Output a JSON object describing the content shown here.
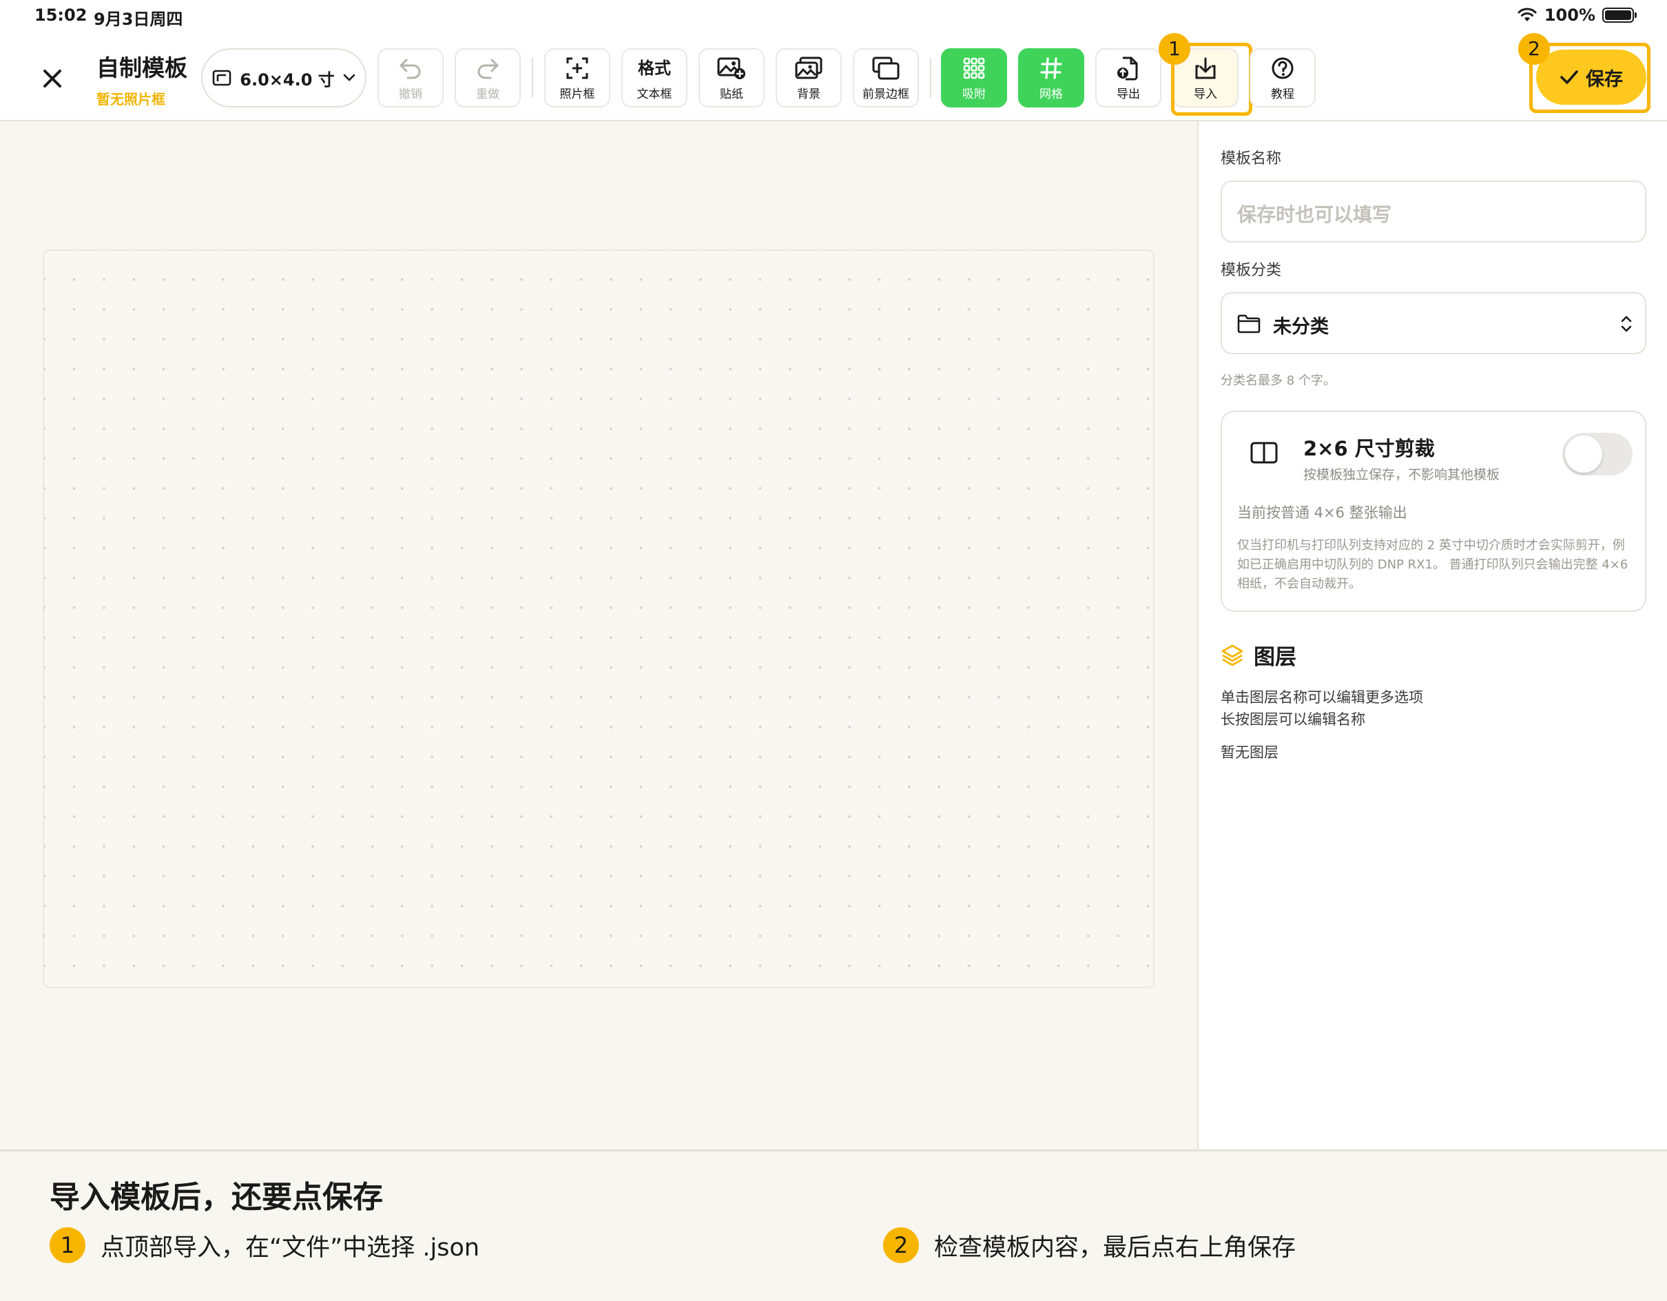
{
  "status_bar": {
    "time": "15:02",
    "date": "9月3日周四",
    "battery": "100%"
  },
  "header": {
    "title": "自制模板",
    "subtitle": "暂无照片框",
    "size_selector": "6.0×4.0 寸"
  },
  "toolbar": {
    "undo": "撤销",
    "redo": "重做",
    "photo_frame": "照片框",
    "format_text": "格式",
    "text_box": "文本框",
    "sticker": "贴纸",
    "background": "背景",
    "foreground_border": "前景边框",
    "snap": "吸附",
    "grid": "网格",
    "export": "导出",
    "import": "导入",
    "tutorial": "教程",
    "save": "保存"
  },
  "badges": {
    "import_step": "1",
    "save_step": "2"
  },
  "panel": {
    "template_name_label": "模板名称",
    "template_name_placeholder": "保存时也可以填写",
    "category_label": "模板分类",
    "category_value": "未分类",
    "category_hint": "分类名最多 8 个字。",
    "crop": {
      "title": "2×6 尺寸剪裁",
      "subtitle": "按模板独立保存，不影响其他模板",
      "toggle_on": false,
      "status": "当前按普通 4×6 整张输出",
      "description": "仅当打印机与打印队列支持对应的 2 英寸中切介质时才会实际剪开，例如已正确启用中切队列的 DNP RX1。 普通打印队列只会输出完整 4×6 相纸，不会自动裁开。"
    },
    "layers": {
      "title": "图层",
      "tip1": "单击图层名称可以编辑更多选项",
      "tip2": "长按图层可以编辑名称",
      "empty": "暂无图层"
    }
  },
  "instructions": {
    "title": "导入模板后，还要点保存",
    "steps": [
      {
        "num": "1",
        "text": "点顶部导入，在“文件”中选择 .json"
      },
      {
        "num": "2",
        "text": "检查模板内容，最后点右上角保存"
      }
    ]
  },
  "colors": {
    "accent_yellow": "#f7b500",
    "save_yellow": "#ffc81e",
    "active_green": "#3fd35a",
    "background": "#f8f6f1"
  },
  "icons": {
    "close": "close-icon",
    "size": "canvas-size-icon",
    "undo": "undo-icon",
    "redo": "redo-icon",
    "photo_frame": "add-frame-icon",
    "sticker": "add-image-icon",
    "background": "images-icon",
    "foreground_border": "overlap-icon",
    "snap": "grid-dots-icon",
    "grid": "hash-icon",
    "export": "export-file-icon",
    "import": "import-icon",
    "tutorial": "help-icon",
    "save": "check-icon",
    "folder": "folder-icon",
    "select": "chevron-updown-icon",
    "crop": "split-icon",
    "layers": "layers-icon"
  }
}
